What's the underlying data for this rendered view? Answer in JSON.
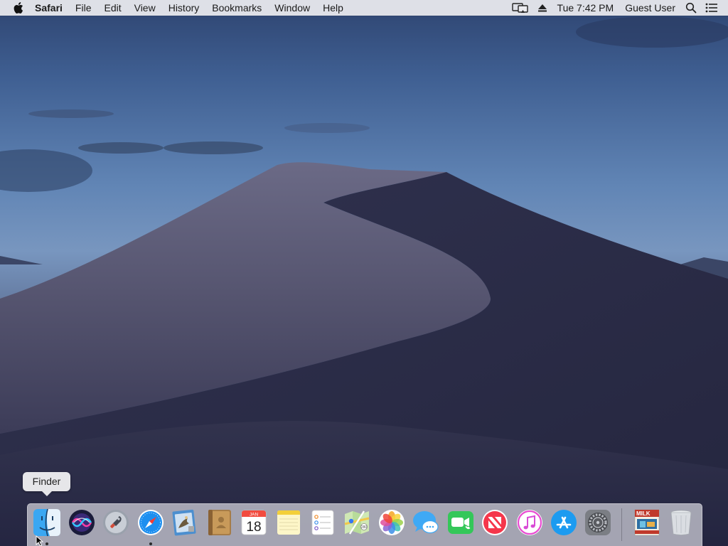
{
  "menubar": {
    "app_name": "Safari",
    "menus": [
      "File",
      "Edit",
      "View",
      "History",
      "Bookmarks",
      "Window",
      "Help"
    ],
    "clock": "Tue 7:42 PM",
    "user": "Guest User"
  },
  "tooltip": {
    "label": "Finder"
  },
  "dock": {
    "apps": [
      {
        "name": "Finder",
        "icon": "finder-icon",
        "running": true
      },
      {
        "name": "Siri",
        "icon": "siri-icon",
        "running": false
      },
      {
        "name": "Launchpad",
        "icon": "launchpad-icon",
        "running": false
      },
      {
        "name": "Safari",
        "icon": "safari-icon",
        "running": true
      },
      {
        "name": "Mail",
        "icon": "mail-icon",
        "running": false
      },
      {
        "name": "Contacts",
        "icon": "contacts-icon",
        "running": false
      },
      {
        "name": "Calendar",
        "icon": "calendar-icon",
        "running": false,
        "month": "JAN",
        "day": "18"
      },
      {
        "name": "Notes",
        "icon": "notes-icon",
        "running": false
      },
      {
        "name": "Reminders",
        "icon": "reminders-icon",
        "running": false
      },
      {
        "name": "Maps",
        "icon": "maps-icon",
        "running": false
      },
      {
        "name": "Photos",
        "icon": "photos-icon",
        "running": false
      },
      {
        "name": "Messages",
        "icon": "messages-icon",
        "running": false
      },
      {
        "name": "FaceTime",
        "icon": "facetime-icon",
        "running": false
      },
      {
        "name": "News",
        "icon": "news-icon",
        "running": false
      },
      {
        "name": "iTunes",
        "icon": "itunes-icon",
        "running": false
      },
      {
        "name": "App Store",
        "icon": "app-store-icon",
        "running": false
      },
      {
        "name": "System Preferences",
        "icon": "system-preferences-icon",
        "running": false
      }
    ],
    "stack": {
      "name": "Downloads",
      "icon": "downloads-stack-icon",
      "label": "MILK"
    },
    "trash": {
      "name": "Trash",
      "icon": "trash-icon"
    }
  },
  "colors": {
    "menubar_bg": "#ececf0",
    "sky_top": "#2e4470",
    "sky_mid": "#6185b5",
    "dune_light": "#5d5d78",
    "dune_shadow": "#2b2c47"
  }
}
